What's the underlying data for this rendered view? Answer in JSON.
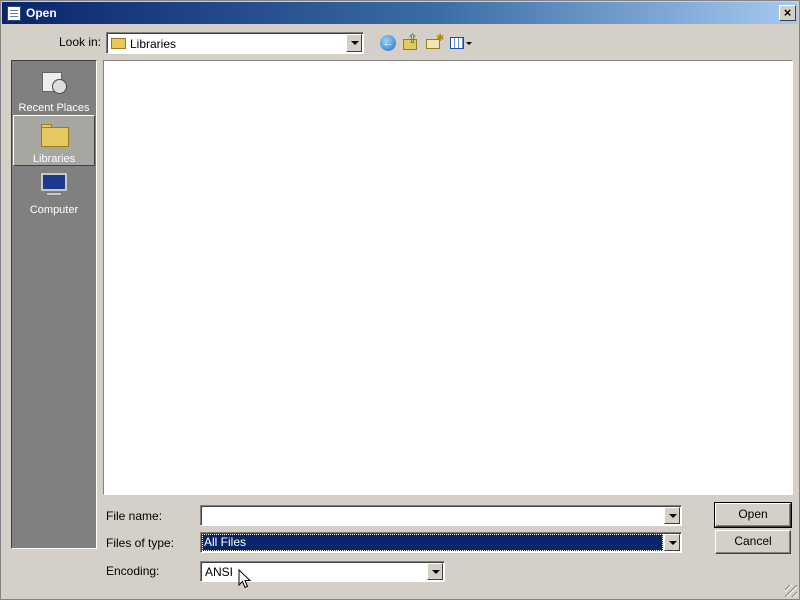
{
  "window": {
    "title": "Open",
    "close_symbol": "×"
  },
  "toolbar": {
    "lookin_label": "Look in:",
    "lookin_value": "Libraries",
    "icons": [
      "back-icon",
      "up-folder-icon",
      "new-folder-icon",
      "view-menu-icon"
    ]
  },
  "places": [
    {
      "label": "Recent Places",
      "icon": "recent-places-icon"
    },
    {
      "label": "Libraries",
      "icon": "libraries-icon",
      "selected": true
    },
    {
      "label": "Computer",
      "icon": "computer-icon"
    }
  ],
  "form": {
    "filename_label": "File name:",
    "filename_value": "",
    "filetype_label": "Files of type:",
    "filetype_value": "All Files",
    "encoding_label": "Encoding:",
    "encoding_value": "ANSI"
  },
  "buttons": {
    "open": "Open",
    "cancel": "Cancel"
  },
  "colors": {
    "titlebar_start": "#0a246a",
    "titlebar_end": "#a6caf0",
    "selection": "#0a246a",
    "dialog_bg": "#d4d0c8"
  }
}
